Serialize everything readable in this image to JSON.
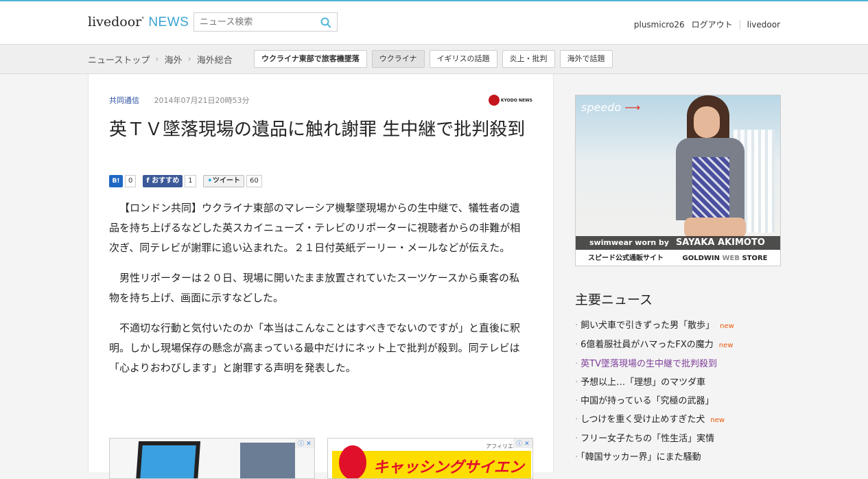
{
  "header": {
    "logo_main": "livedoor",
    "logo_news": "NEWS",
    "search_placeholder": "ニュース検索",
    "username": "plusmicro26",
    "logout": "ログアウト",
    "livedoor_link": "livedoor"
  },
  "nav": {
    "breadcrumbs": [
      "ニューストップ",
      "海外",
      "海外総合"
    ],
    "tags": [
      {
        "label": "ウクライナ東部で旅客機墜落",
        "bold": true
      },
      {
        "label": "ウクライナ",
        "active": true
      },
      {
        "label": "イギリスの話題"
      },
      {
        "label": "炎上・批判"
      },
      {
        "label": "海外で話題"
      }
    ]
  },
  "article": {
    "source": "共同通信",
    "date": "2014年07月21日20時53分",
    "kyodo_logo": "KYODO NEWS",
    "title": "英ＴＶ墜落現場の遺品に触れ謝罪 生中継で批判殺到",
    "social": {
      "hatena_label": "B!",
      "hatena_count": "0",
      "facebook_label": "おすすめ",
      "facebook_count": "1",
      "tweet_label": "ツイート",
      "tweet_count": "60"
    },
    "paragraphs": [
      "【ロンドン共同】ウクライナ東部のマレーシア機撃墜現場からの生中継で、犠牲者の遺品を持ち上げるなどした英スカイニューズ・テレビのリポーターに視聴者からの非難が相次ぎ、同テレビが謝罪に追い込まれた。２１日付英紙デーリー・メールなどが伝えた。",
      "男性リポーターは２０日、現場に開いたまま放置されていたスーツケースから乗客の私物を持ち上げ、画面に示すなどした。",
      "不適切な行動と気付いたのか「本当はこんなことはすべきでないのですが」と直後に釈明。しかし現場保存の懸念が高まっている最中だけにネット上で批判が殺到。同テレビは「心よりおわびします」と謝罪する声明を発表した。"
    ],
    "ad_affiliate_label": "アフィリエ",
    "ad_text": "キャッシングサイエンス"
  },
  "sidebar": {
    "ad": {
      "brand": "speedo",
      "caption_small": "swimwear worn by",
      "caption_big": "SAYAKA AKIMOTO",
      "footer_left": "スピード公式通販サイト",
      "footer_goldwin": "GOLDWIN",
      "footer_web": "WEB",
      "footer_store": "STORE"
    },
    "news_heading": "主要ニュース",
    "new_label": "new",
    "news": [
      {
        "title": "飼い犬車で引きずった男「散歩」",
        "new": true,
        "visited": false
      },
      {
        "title": "6億着服社員がハマったFXの魔力",
        "new": true,
        "visited": false
      },
      {
        "title": "英TV墜落現場の生中継で批判殺到",
        "new": false,
        "visited": true
      },
      {
        "title": "予想以上…「理想」のマツダ車",
        "new": false,
        "visited": false
      },
      {
        "title": "中国が持っている「究極の武器」",
        "new": false,
        "visited": false
      },
      {
        "title": "しつけを重く受け止めすぎた犬",
        "new": true,
        "visited": false
      },
      {
        "title": "フリー女子たちの「性生活」実情",
        "new": false,
        "visited": false
      },
      {
        "title": "「韓国サッカー界」にまた騒動",
        "new": false,
        "visited": false
      }
    ]
  },
  "colors": {
    "accent": "#4fb5d6",
    "source_link": "#2b4fa0",
    "new_badge": "#e8590c",
    "visited": "#7d3c98"
  }
}
